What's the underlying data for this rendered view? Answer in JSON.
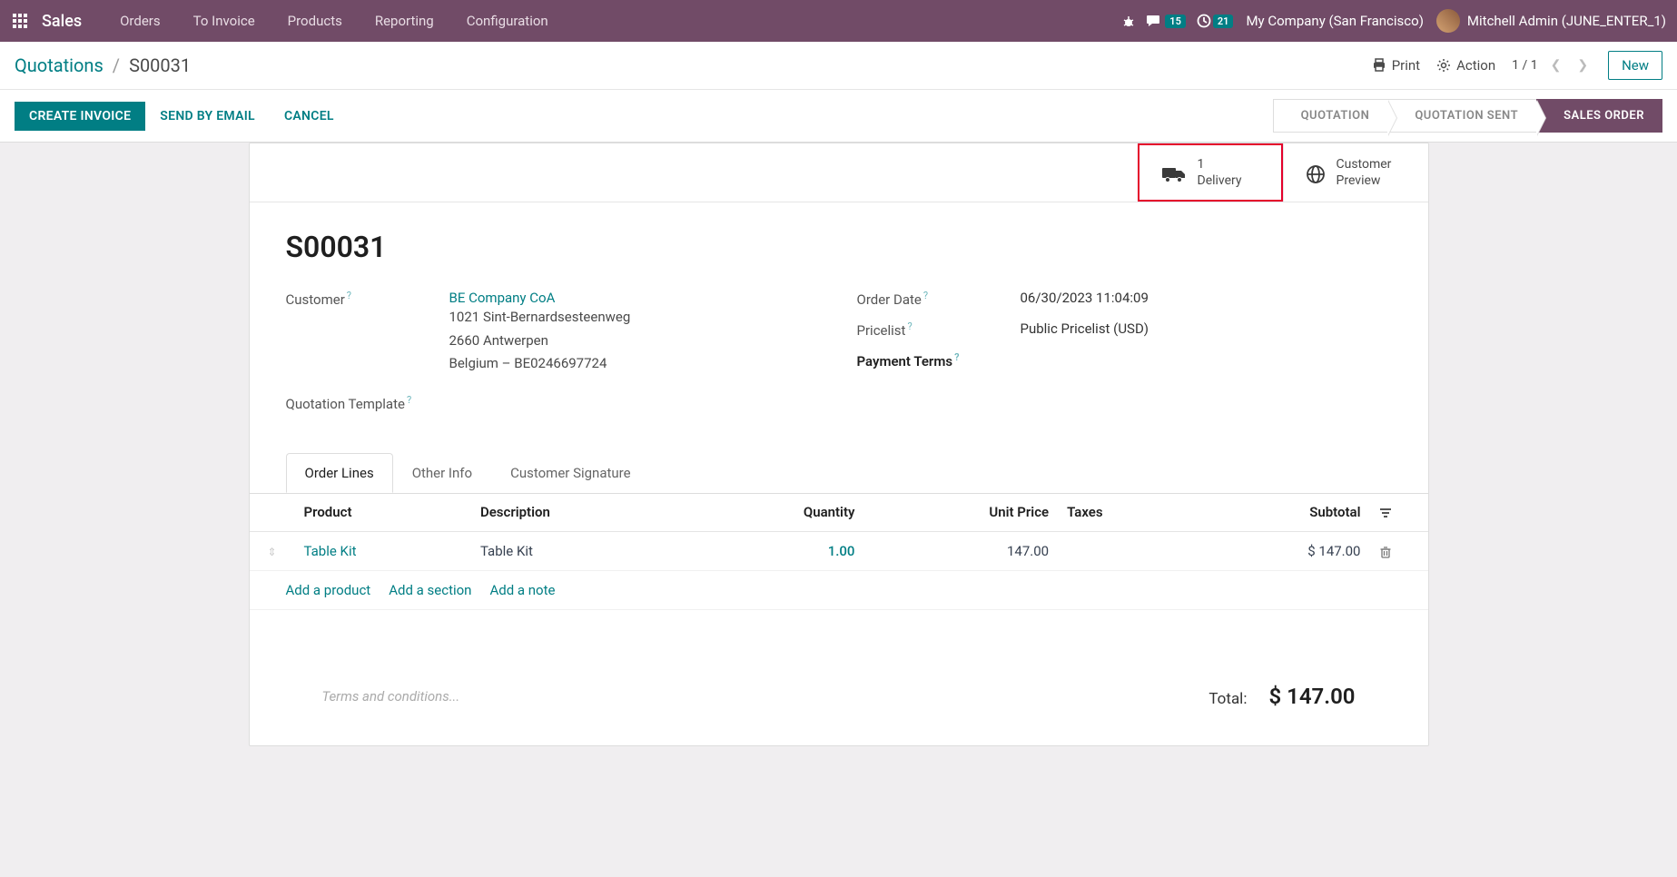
{
  "navbar": {
    "app_title": "Sales",
    "menu": [
      "Orders",
      "To Invoice",
      "Products",
      "Reporting",
      "Configuration"
    ],
    "msg_badge": "15",
    "act_badge": "21",
    "company": "My Company (San Francisco)",
    "user": "Mitchell Admin (JUNE_ENTER_1)"
  },
  "breadcrumb": {
    "parent": "Quotations",
    "current": "S00031"
  },
  "actions": {
    "print": "Print",
    "action": "Action",
    "pager": "1 / 1",
    "new": "New"
  },
  "buttons": {
    "create_invoice": "CREATE INVOICE",
    "send_email": "SEND BY EMAIL",
    "cancel": "CANCEL"
  },
  "status": {
    "quotation": "QUOTATION",
    "quotation_sent": "QUOTATION SENT",
    "sales_order": "SALES ORDER"
  },
  "stat_buttons": {
    "delivery_count": "1",
    "delivery_label": "Delivery",
    "preview_line1": "Customer",
    "preview_line2": "Preview"
  },
  "order": {
    "name": "S00031",
    "customer_label": "Customer",
    "customer_name": "BE Company CoA",
    "addr1": "1021 Sint-Bernardsesteenweg",
    "addr2": "2660 Antwerpen",
    "addr3": "Belgium – BE0246697724",
    "template_label": "Quotation Template",
    "order_date_label": "Order Date",
    "order_date": "06/30/2023 11:04:09",
    "pricelist_label": "Pricelist",
    "pricelist": "Public Pricelist (USD)",
    "payment_terms_label": "Payment Terms"
  },
  "tabs": {
    "order_lines": "Order Lines",
    "other_info": "Other Info",
    "signature": "Customer Signature"
  },
  "table": {
    "headers": {
      "product": "Product",
      "description": "Description",
      "quantity": "Quantity",
      "unit_price": "Unit Price",
      "taxes": "Taxes",
      "subtotal": "Subtotal"
    },
    "rows": [
      {
        "product": "Table Kit",
        "description": "Table Kit",
        "quantity": "1.00",
        "unit_price": "147.00",
        "taxes": "",
        "subtotal": "$ 147.00"
      }
    ],
    "add_product": "Add a product",
    "add_section": "Add a section",
    "add_note": "Add a note"
  },
  "footer": {
    "terms_placeholder": "Terms and conditions...",
    "total_label": "Total:",
    "total_value": "$ 147.00"
  }
}
